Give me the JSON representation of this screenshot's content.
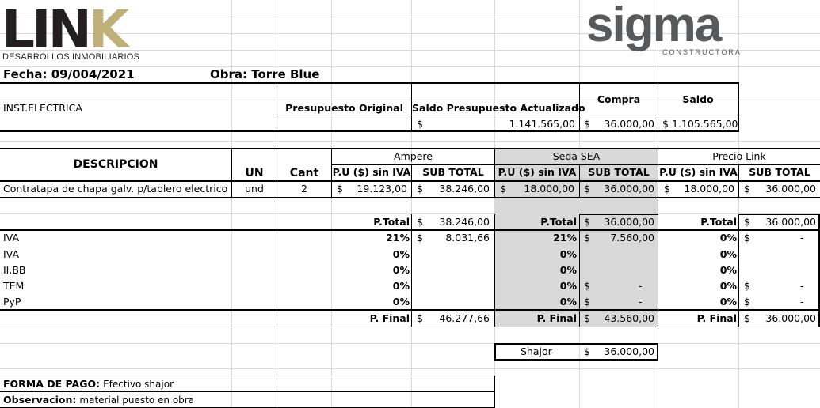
{
  "header": {
    "logo_left_main": "LIN",
    "logo_left_k": "K",
    "logo_left_sub": "DESARROLLOS INMOBILIARIOS",
    "logo_right": "sigma",
    "logo_right_sub": "CONSTRUCTORA",
    "fecha": "Fecha: 09/004/2021",
    "obra": "Obra:  Torre Blue"
  },
  "summary": {
    "section": "INST.ELECTRICA",
    "col_presupuesto": "Presupuesto Original",
    "col_saldo_pres": "Saldo Presupuesto Actualizado",
    "col_compra": "Compra",
    "col_saldo": "Saldo",
    "currency": "$",
    "saldo_pres_value": "1.141.565,00",
    "compra_value": "36.000,00",
    "saldo_value": "1.105.565,00"
  },
  "table": {
    "descripcion": "DESCRIPCION",
    "un": "UN",
    "cant": "Cant",
    "pu": "P.U ($) sin IVA",
    "subtotal": "SUB TOTAL",
    "providers": [
      "Ampere",
      "Seda SEA",
      "Precio Link"
    ],
    "item": {
      "desc": "Contratapa de chapa galv. p/tablero electrico",
      "un": "und",
      "cant": "2",
      "ampere_pu": "19.123,00",
      "ampere_sub": "38.246,00",
      "seda_pu": "18.000,00",
      "seda_sub": "36.000,00",
      "link_pu": "18.000,00",
      "link_sub": "36.000,00"
    }
  },
  "totals": {
    "ptotal_label": "P.Total",
    "pfinal_label": "P. Final",
    "dash": "-",
    "rows": [
      "IVA",
      "IVA",
      "II.BB",
      "TEM",
      "PyP"
    ],
    "ampere": {
      "ptotal": "38.246,00",
      "pct": [
        "21%",
        "0%",
        "0%",
        "0%",
        "0%"
      ],
      "iva": "8.031,66",
      "pfinal": "46.277,66"
    },
    "seda": {
      "ptotal": "36.000,00",
      "pct": [
        "21%",
        "0%",
        "0%",
        "0%",
        "0%"
      ],
      "iva": "7.560,00",
      "pfinal": "43.560,00"
    },
    "link": {
      "ptotal": "36.000,00",
      "pct": [
        "0%",
        "0%",
        "0%",
        "0%",
        "0%"
      ],
      "pfinal": "36.000,00"
    }
  },
  "shajor": {
    "label": "Shajor",
    "value": "36.000,00"
  },
  "footer": {
    "forma_label": "FORMA DE PAGO:",
    "forma_value": "Efectivo shajor",
    "obs_label": "Observacion:",
    "obs_value": "material puesto en obra"
  }
}
